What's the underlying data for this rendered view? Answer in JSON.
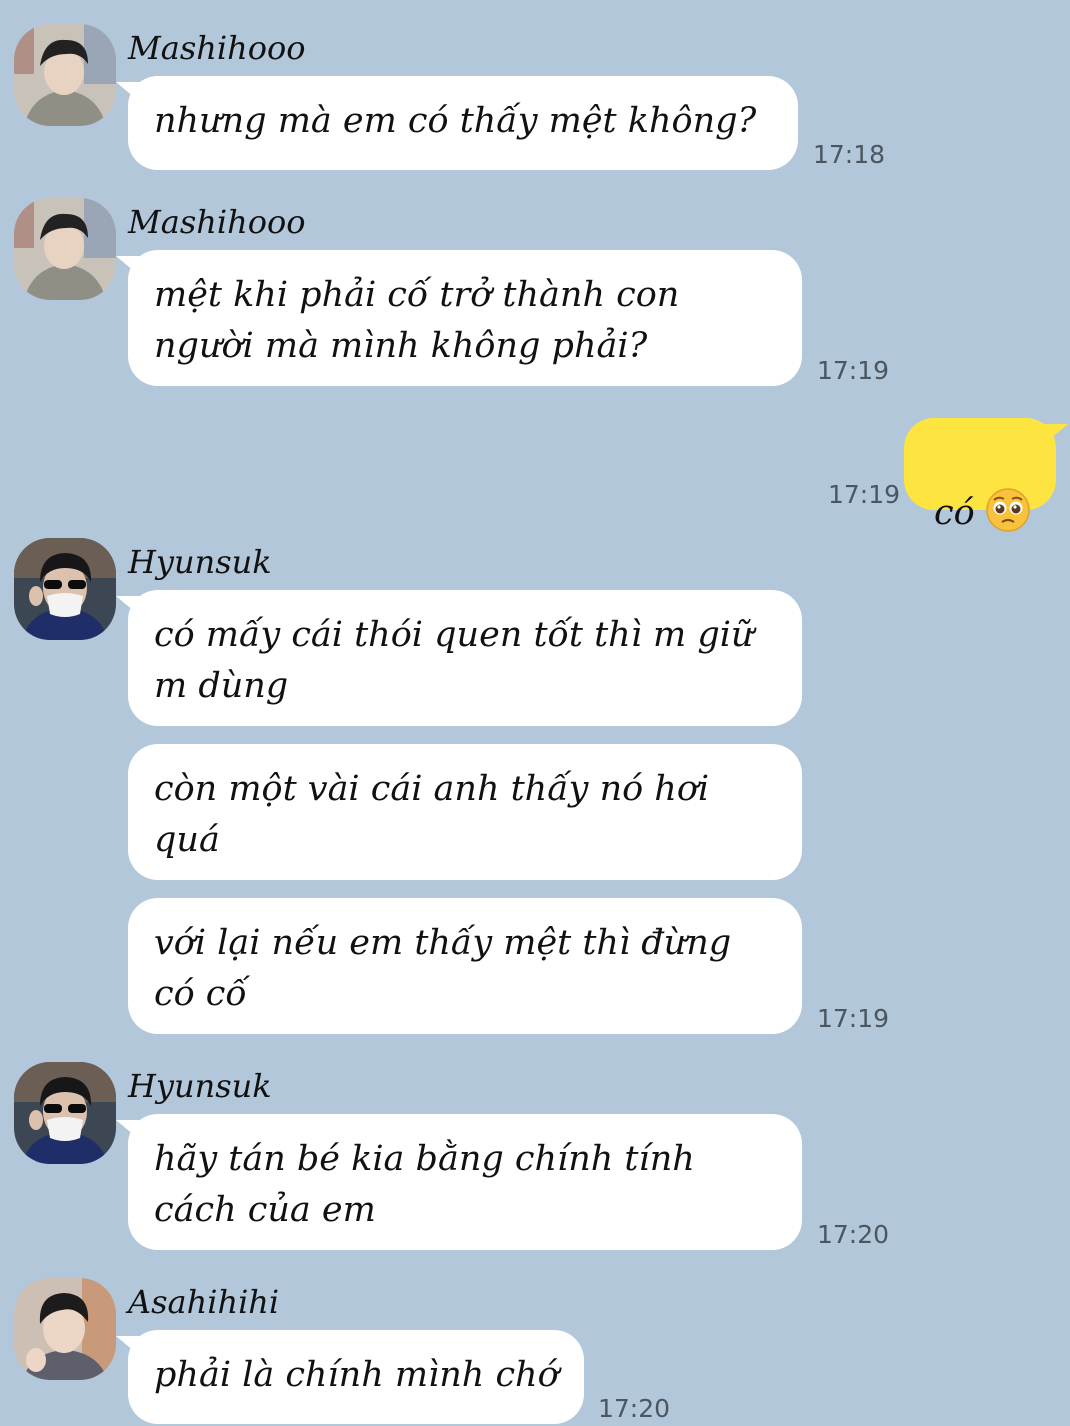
{
  "colors": {
    "background": "#b2c7da",
    "incoming_bubble": "#ffffff",
    "outgoing_bubble": "#fee440",
    "timestamp": "#4b5660"
  },
  "messages": [
    {
      "sender": "Mashihooo",
      "text": "nhưng mà em có thấy mệt không?",
      "time": "17:18",
      "avatar": "avatar-mashiho"
    },
    {
      "sender": "Mashihooo",
      "text": "mệt khi phải cố trở thành con\nngười mà mình không phải?",
      "time": "17:19",
      "avatar": "avatar-mashiho"
    },
    {
      "sender": "me",
      "text": "có",
      "emoji": "pleading-face-icon",
      "time": "17:19"
    },
    {
      "sender": "Hyunsuk",
      "avatar": "avatar-hyunsuk",
      "lines": [
        "có mấy cái thói quen tốt thì m giữ\nm dùng",
        "còn một vài cái anh thấy nó hơi\nquá",
        "với lại nếu em thấy mệt thì đừng\ncó cố"
      ],
      "time": "17:19"
    },
    {
      "sender": "Hyunsuk",
      "text": "hãy tán bé kia bằng chính tính\ncách của em",
      "time": "17:20",
      "avatar": "avatar-hyunsuk"
    },
    {
      "sender": "Asahihihi",
      "text": "phải là chính mình chớ",
      "time": "17:20",
      "avatar": "avatar-asahi"
    }
  ]
}
